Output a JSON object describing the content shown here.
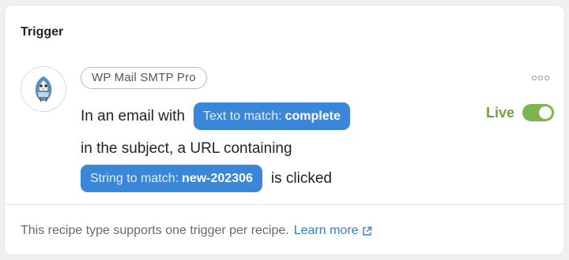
{
  "card": {
    "title": "Trigger"
  },
  "integration": {
    "name": "WP Mail SMTP Pro",
    "icon": "wp-mail-smtp-bird-icon"
  },
  "status": {
    "label": "Live",
    "enabled": true,
    "color": "#6ea348"
  },
  "sentence": {
    "line1_prefix": "In an email with",
    "token1": {
      "label": "Text to match:",
      "value": "complete"
    },
    "line2": "in the subject, a URL containing",
    "token2": {
      "label": "String to match:",
      "value": "new-202306"
    },
    "line3_suffix": "is clicked"
  },
  "footer": {
    "text": "This recipe type supports one trigger per recipe.",
    "link_label": "Learn more"
  },
  "colors": {
    "token_bg": "#3a86d8",
    "link": "#2f7fd3",
    "toggle_on": "#7cb44f"
  }
}
